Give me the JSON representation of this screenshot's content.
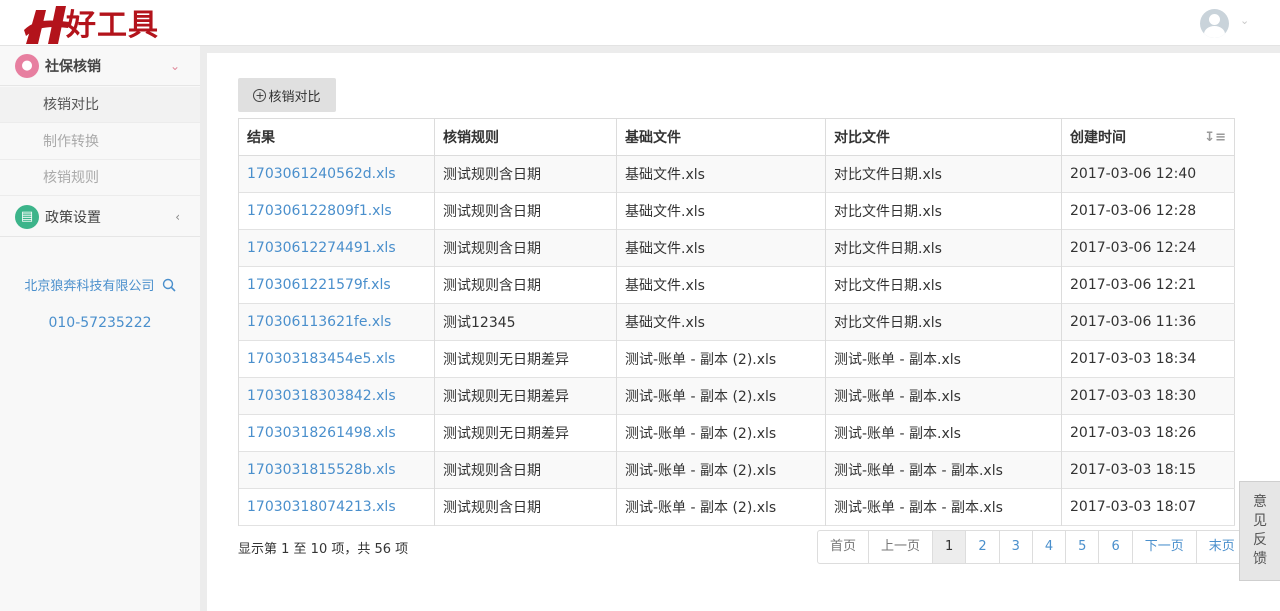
{
  "header": {
    "logo_text": "好工具"
  },
  "sidebar": {
    "group1": {
      "label": "社保核销",
      "icon": "user-group-icon",
      "color": "#e77fa0"
    },
    "sub_items": [
      "核销对比",
      "制作转换",
      "核销规则"
    ],
    "group2": {
      "label": "政策设置",
      "icon": "document-icon",
      "color": "#3cb48a"
    },
    "company_name": "北京狼奔科技有限公司",
    "phone": "010-57235222"
  },
  "toolbar": {
    "add_label": "核销对比"
  },
  "table": {
    "headers": [
      "结果",
      "核销规则",
      "基础文件",
      "对比文件",
      "创建时间"
    ],
    "rows": [
      [
        "1703061240562d.xls",
        "测试规则含日期",
        "基础文件.xls",
        "对比文件日期.xls",
        "2017-03-06 12:40"
      ],
      [
        "170306122809f1.xls",
        "测试规则含日期",
        "基础文件.xls",
        "对比文件日期.xls",
        "2017-03-06 12:28"
      ],
      [
        "17030612274491.xls",
        "测试规则含日期",
        "基础文件.xls",
        "对比文件日期.xls",
        "2017-03-06 12:24"
      ],
      [
        "1703061221579f.xls",
        "测试规则含日期",
        "基础文件.xls",
        "对比文件日期.xls",
        "2017-03-06 12:21"
      ],
      [
        "170306113621fe.xls",
        "测试12345",
        "基础文件.xls",
        "对比文件日期.xls",
        "2017-03-06 11:36"
      ],
      [
        "170303183454e5.xls",
        "测试规则无日期差异",
        "测试-账单 - 副本 (2).xls",
        "测试-账单 - 副本.xls",
        "2017-03-03 18:34"
      ],
      [
        "17030318303842.xls",
        "测试规则无日期差异",
        "测试-账单 - 副本 (2).xls",
        "测试-账单 - 副本.xls",
        "2017-03-03 18:30"
      ],
      [
        "17030318261498.xls",
        "测试规则无日期差异",
        "测试-账单 - 副本 (2).xls",
        "测试-账单 - 副本.xls",
        "2017-03-03 18:26"
      ],
      [
        "1703031815528b.xls",
        "测试规则含日期",
        "测试-账单 - 副本 (2).xls",
        "测试-账单 - 副本 - 副本.xls",
        "2017-03-03 18:15"
      ],
      [
        "17030318074213.xls",
        "测试规则含日期",
        "测试-账单 - 副本 (2).xls",
        "测试-账单 - 副本 - 副本.xls",
        "2017-03-03 18:07"
      ]
    ]
  },
  "pagination": {
    "info": "显示第 1 至 10 项，共 56 项",
    "first": "首页",
    "prev": "上一页",
    "pages": [
      "1",
      "2",
      "3",
      "4",
      "5",
      "6"
    ],
    "next": "下一页",
    "last": "末页"
  },
  "feedback": [
    "意",
    "见",
    "反",
    "馈"
  ]
}
